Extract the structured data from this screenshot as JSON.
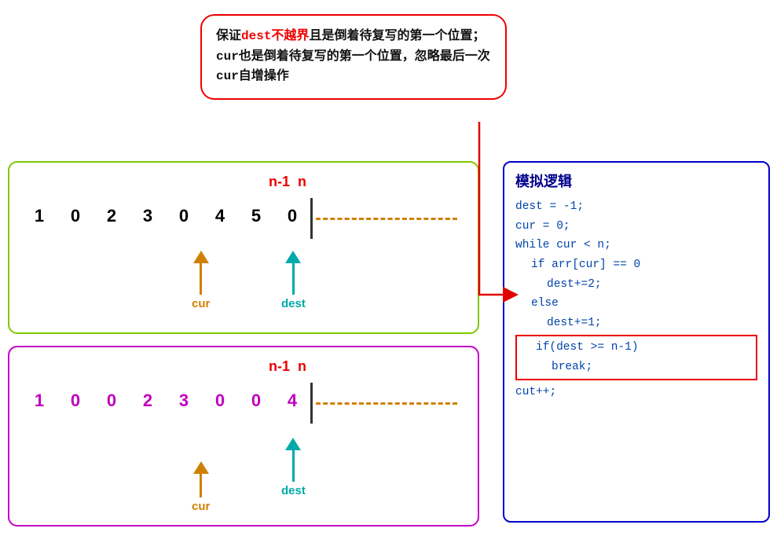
{
  "tooltip": {
    "line1_pre": "保证",
    "line1_red": "dest不越界",
    "line1_post": "且是倒着待复写的第一个位置；",
    "line2": "cur也是倒着待复写的第一个位置，忽略最后一次",
    "line3": "cur自增操作"
  },
  "code_box": {
    "title": "模拟逻辑",
    "lines": [
      {
        "text": "dest = -1;",
        "indent": 0
      },
      {
        "text": "cur = 0;",
        "indent": 0
      },
      {
        "text": "while cur < n;",
        "indent": 0
      },
      {
        "text": "if arr[cur] == 0",
        "indent": 1
      },
      {
        "text": "dest+=2;",
        "indent": 2
      },
      {
        "text": "else",
        "indent": 1
      },
      {
        "text": "dest+=1;",
        "indent": 2
      },
      {
        "text": "if(dest >= n-1)",
        "indent": 1,
        "highlight": true
      },
      {
        "text": "break;",
        "indent": 2,
        "highlight": true
      },
      {
        "text": "cut++;",
        "indent": 0
      }
    ]
  },
  "top_array": {
    "numbers": [
      "1",
      "0",
      "2",
      "3",
      "0",
      "4",
      "5",
      "0"
    ],
    "n_minus_1": "n-1",
    "n": "n"
  },
  "bottom_array": {
    "numbers": [
      "1",
      "0",
      "0",
      "2",
      "3",
      "0",
      "0",
      "4"
    ],
    "n_minus_1": "n-1",
    "n": "n"
  },
  "colors": {
    "red": "#e00000",
    "orange": "#d08000",
    "cyan": "#00aaaa",
    "blue": "#0044aa",
    "darkblue": "#00008b",
    "green_border": "#7dc900",
    "purple_border": "#c000c0",
    "code_border": "#0000cc"
  }
}
